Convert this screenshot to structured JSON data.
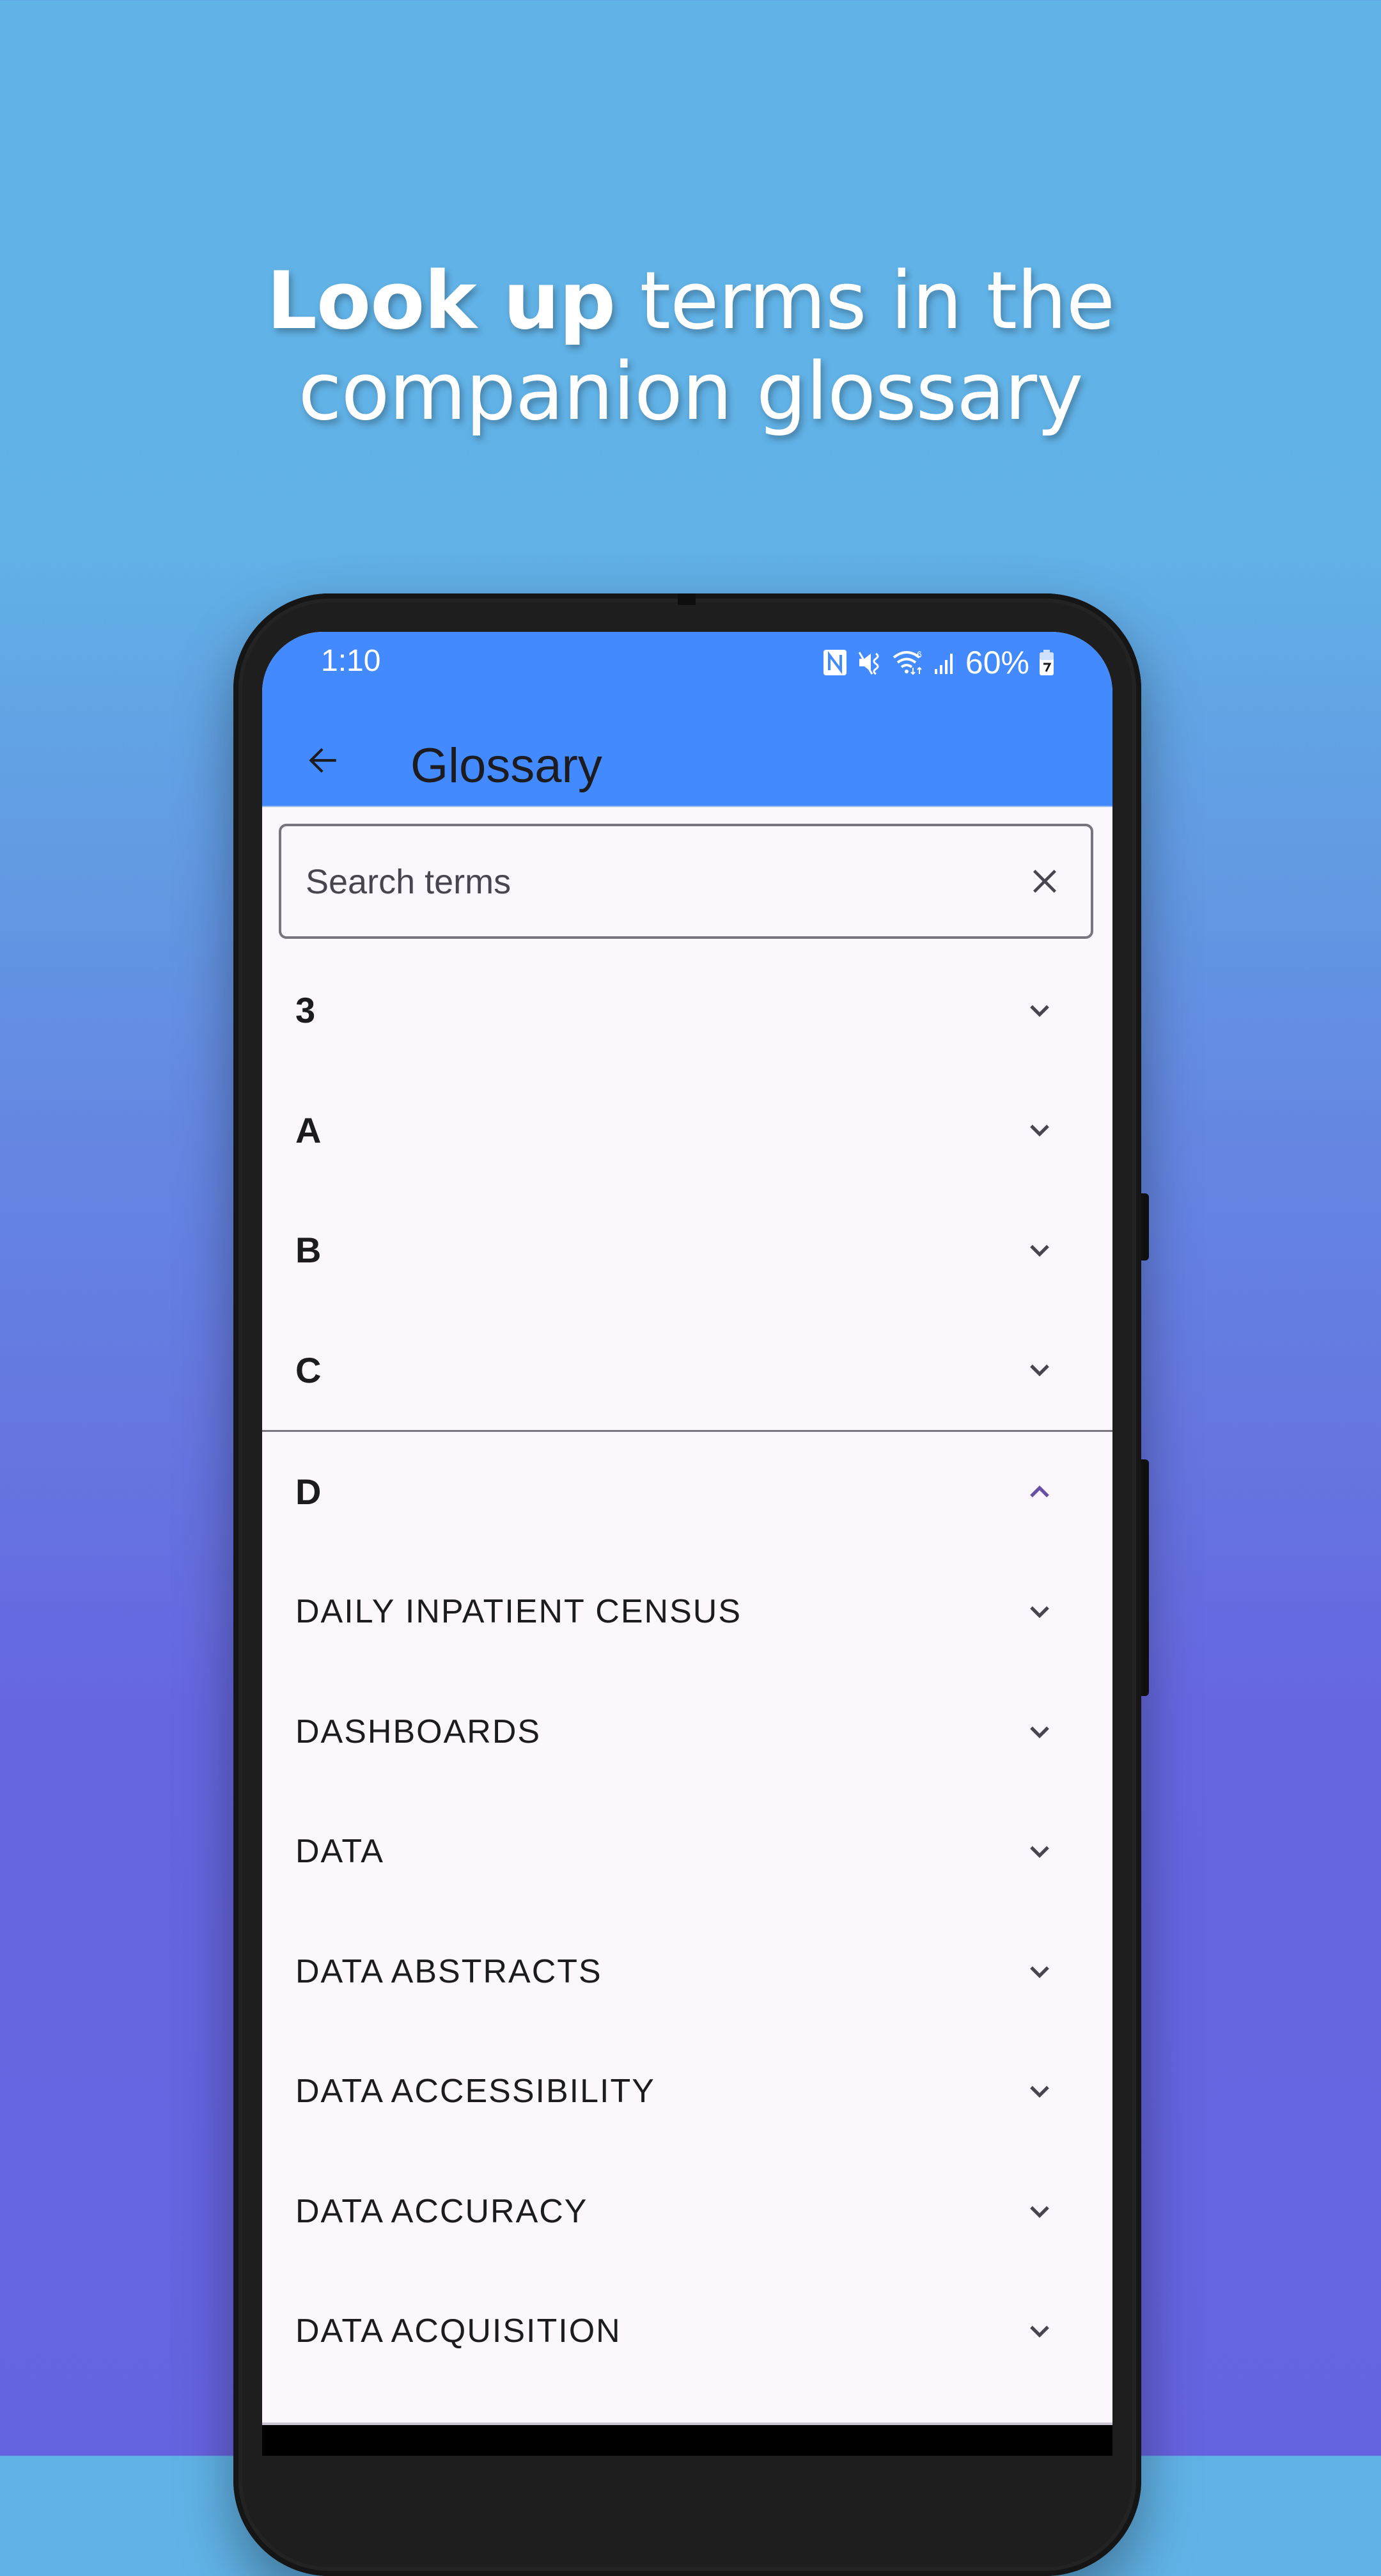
{
  "promo": {
    "headline_bold": "Look up",
    "headline_rest_line1": " terms in the",
    "headline_line2": "companion glossary"
  },
  "status_bar": {
    "time": "1:10",
    "icons": [
      "nfc-icon",
      "mute-vibrate-icon",
      "wifi-6-icon",
      "signal-icon"
    ],
    "battery_percent": "60%",
    "battery_charging": true
  },
  "app_bar": {
    "title": "Glossary",
    "back_icon": "arrow-back-icon"
  },
  "search": {
    "placeholder": "Search terms",
    "value": "",
    "clear_icon": "close-icon"
  },
  "sections": [
    {
      "label": "3",
      "expanded": false
    },
    {
      "label": "A",
      "expanded": false
    },
    {
      "label": "B",
      "expanded": false
    },
    {
      "label": "C",
      "expanded": false
    },
    {
      "label": "D",
      "expanded": true
    }
  ],
  "terms_d": [
    {
      "label": "DAILY INPATIENT CENSUS",
      "expanded": false
    },
    {
      "label": "DASHBOARDS",
      "expanded": false
    },
    {
      "label": "DATA",
      "expanded": false
    },
    {
      "label": "DATA ABSTRACTS",
      "expanded": false
    },
    {
      "label": "DATA ACCESSIBILITY",
      "expanded": false
    },
    {
      "label": "DATA ACCURACY",
      "expanded": false
    },
    {
      "label": "DATA ACQUISITION",
      "expanded": false
    }
  ],
  "colors": {
    "app_bar": "#448AFF",
    "surface": "#FCF7FD",
    "expanded_chevron": "#6750A4",
    "collapsed_chevron": "#49454F",
    "text": "#1C1B1F"
  }
}
